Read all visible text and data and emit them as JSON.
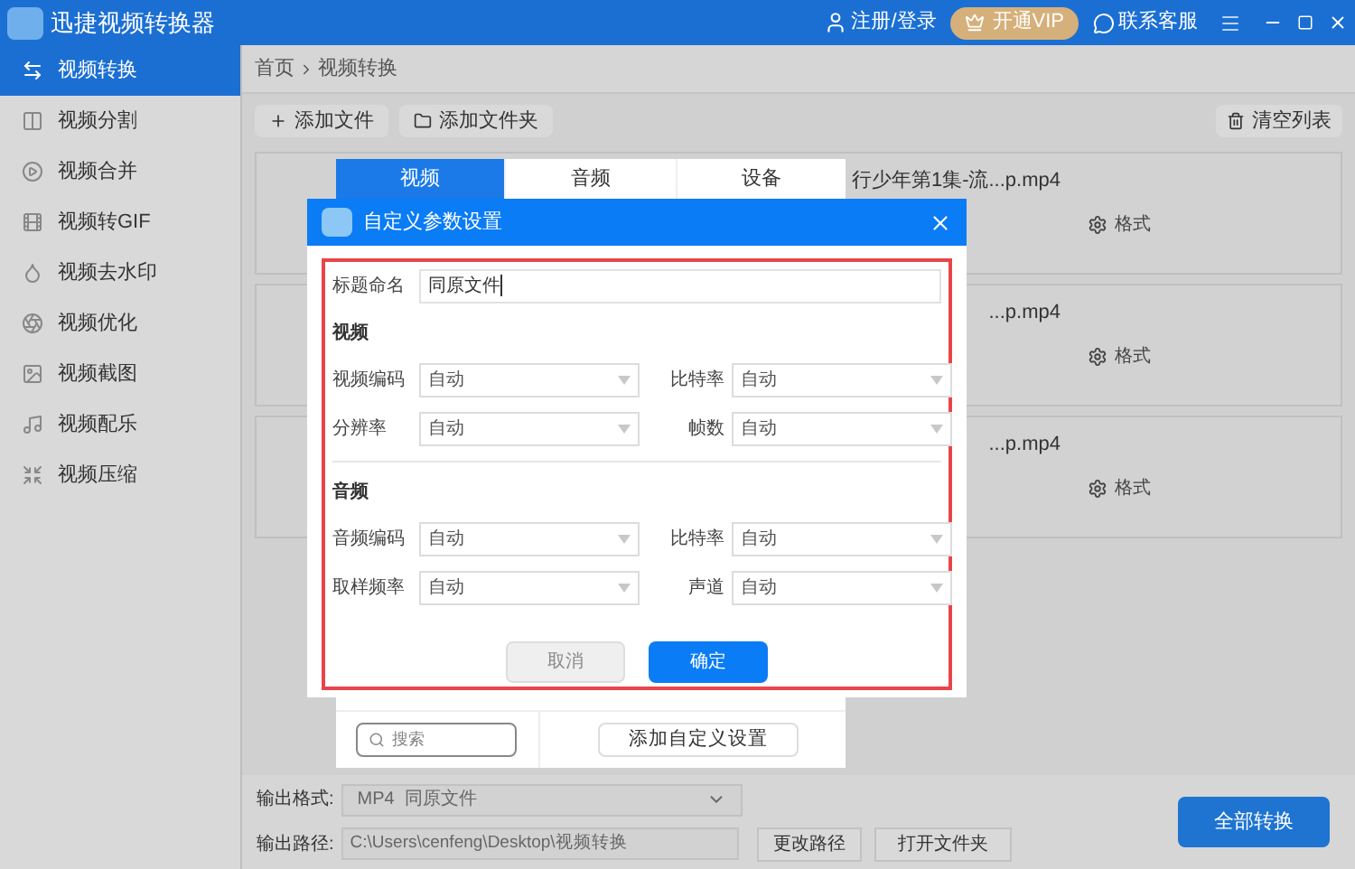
{
  "app": {
    "title": "迅捷视频转换器",
    "account": "注册/登录",
    "vip": "开通VIP",
    "support": "联系客服"
  },
  "sidebar": [
    {
      "label": "视频转换",
      "selected": true
    },
    {
      "label": "视频分割",
      "selected": false
    },
    {
      "label": "视频合并",
      "selected": false
    },
    {
      "label": "视频转GIF",
      "selected": false
    },
    {
      "label": "视频去水印",
      "selected": false
    },
    {
      "label": "视频优化",
      "selected": false
    },
    {
      "label": "视频截图",
      "selected": false
    },
    {
      "label": "视频配乐",
      "selected": false
    },
    {
      "label": "视频压缩",
      "selected": false
    }
  ],
  "breadcrumb": [
    "首页",
    "视频转换"
  ],
  "toolbar": {
    "add_file": "添加文件",
    "add_folder": "添加文件夹",
    "clear": "清空列表"
  },
  "files": [
    {
      "name": "行少年第1集-流...p.mp4",
      "format": "格式"
    },
    {
      "name": "...p.mp4",
      "format": "格式"
    },
    {
      "name": "...p.mp4",
      "format": "格式"
    }
  ],
  "format_panel": {
    "tabs": [
      {
        "label": "视频",
        "selected": true
      },
      {
        "label": "音频",
        "selected": false
      },
      {
        "label": "设备",
        "selected": false
      }
    ],
    "search": {
      "placeholder": "搜索"
    },
    "add_custom": "添加自定义设置"
  },
  "dialog": {
    "title": "自定义参数设置",
    "name_label": "标题命名",
    "name_value": "同原文件",
    "sections": [
      {
        "heading": "视频",
        "fields": [
          {
            "label": "视频编码",
            "value": "自动"
          },
          {
            "label": "比特率",
            "value": "自动"
          },
          {
            "label": "分辨率",
            "value": "自动"
          },
          {
            "label": "帧数",
            "value": "自动"
          }
        ]
      },
      {
        "heading": "音频",
        "fields": [
          {
            "label": "音频编码",
            "value": "自动"
          },
          {
            "label": "比特率",
            "value": "自动"
          },
          {
            "label": "取样频率",
            "value": "自动"
          },
          {
            "label": "声道",
            "value": "自动"
          }
        ]
      }
    ],
    "cancel": "取消",
    "ok": "确定"
  },
  "output": {
    "format_label": "输出格式:",
    "format_value": "MP4  同原文件",
    "path_label": "输出路径:",
    "path_value": "C:\\Users\\cenfeng\\Desktop\\视频转换",
    "change_path": "更改路径",
    "open_folder": "打开文件夹",
    "convert_all": "全部转换"
  }
}
